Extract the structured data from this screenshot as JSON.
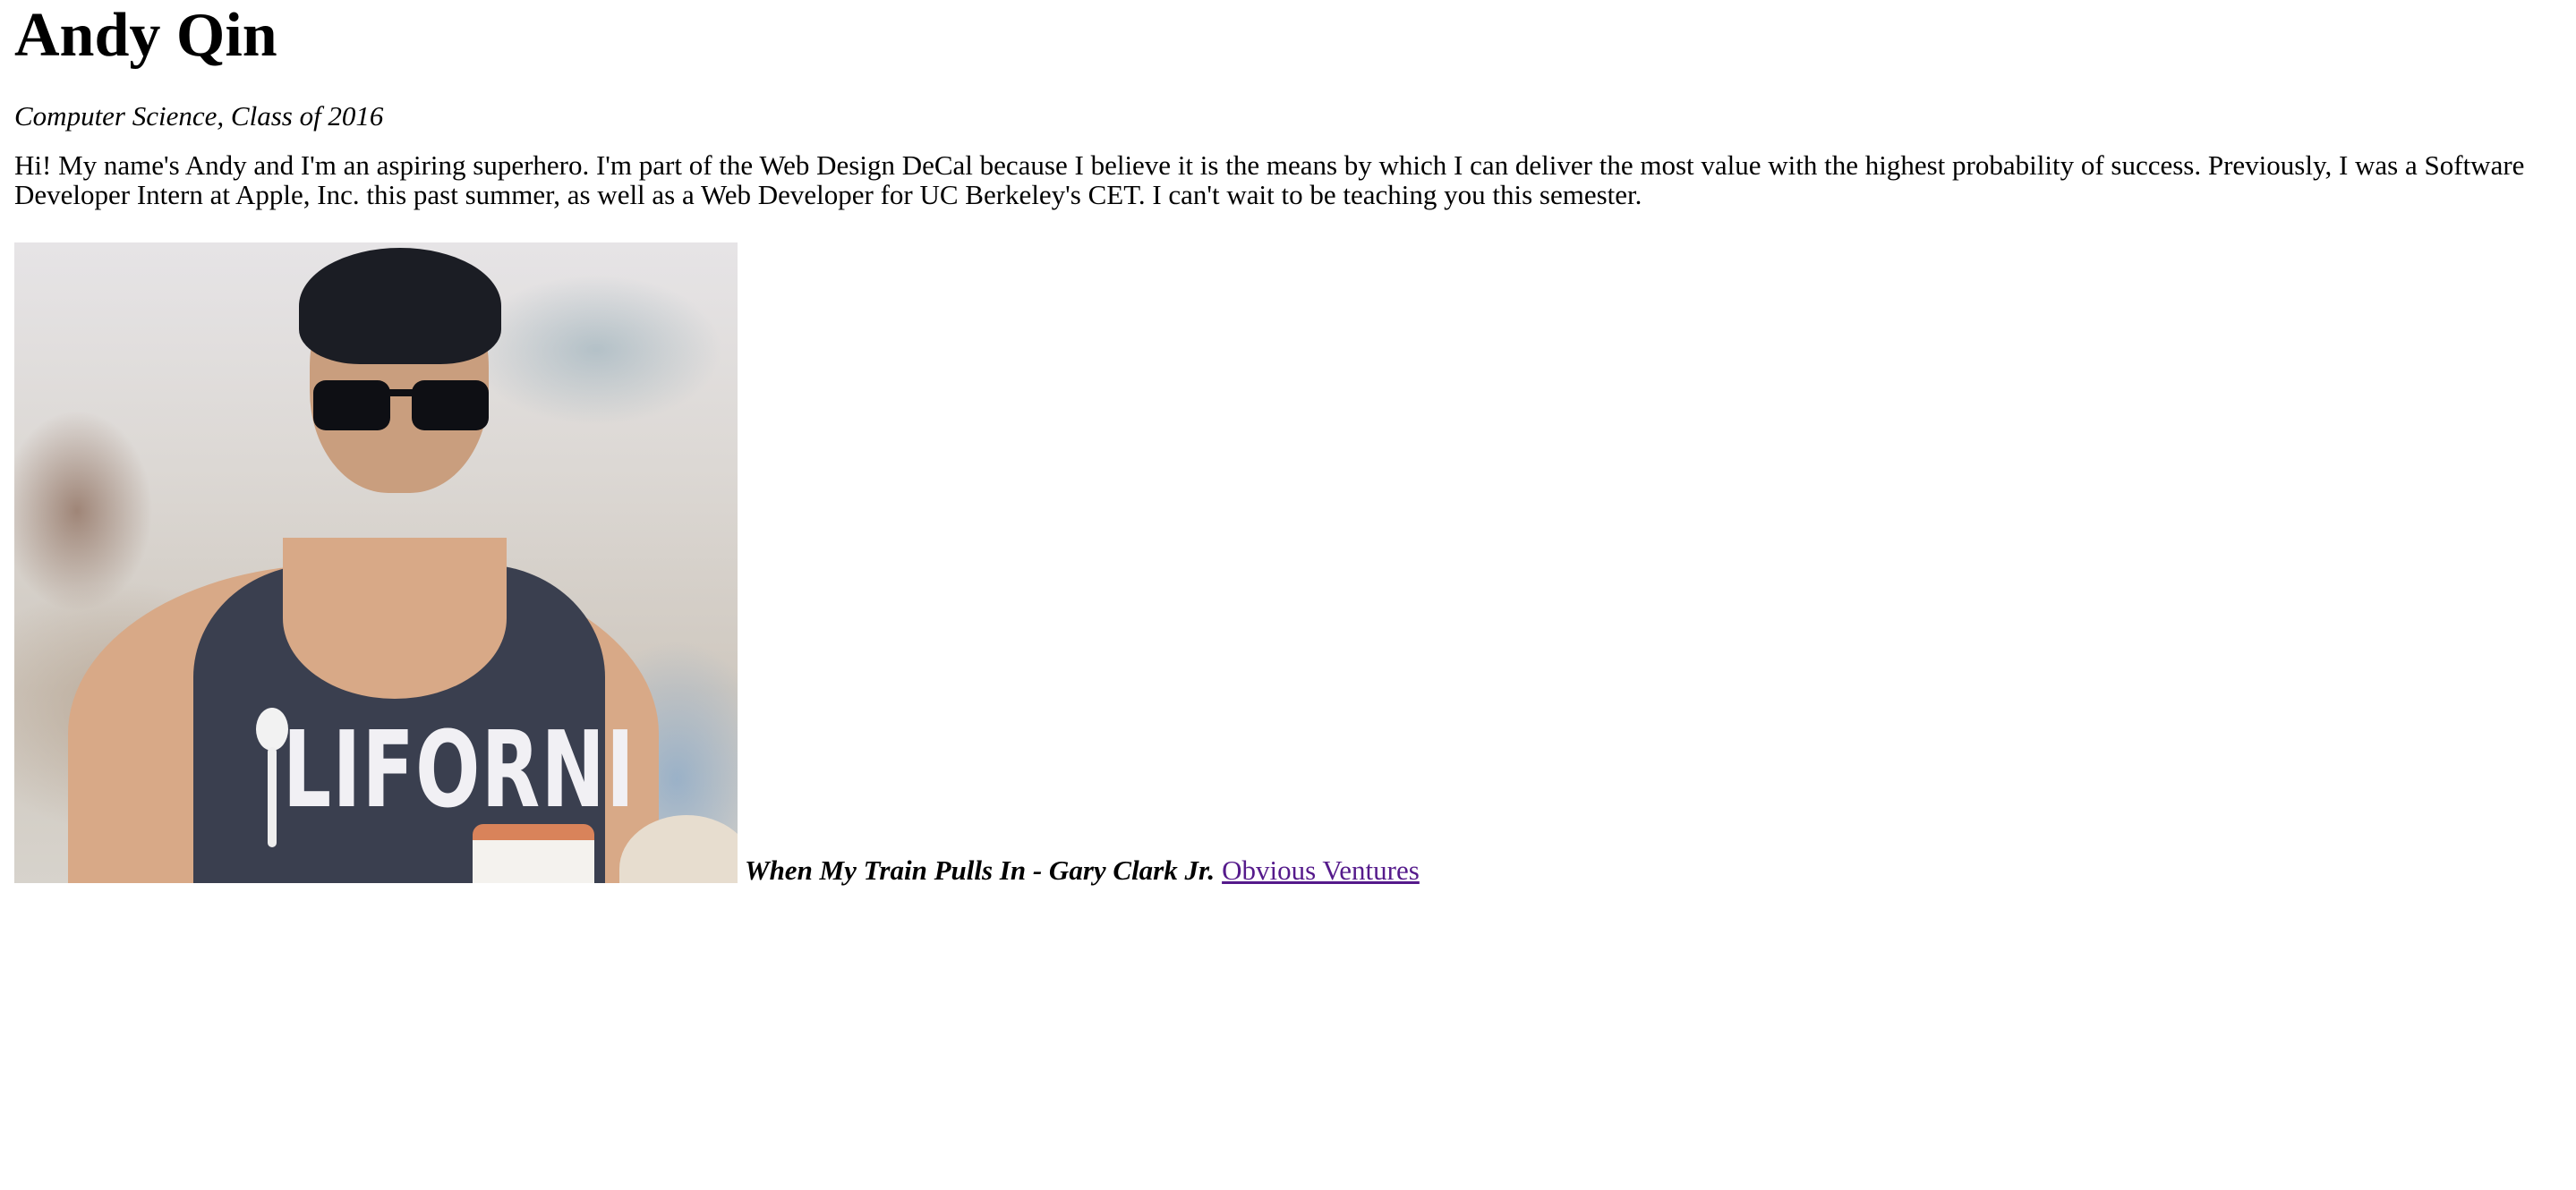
{
  "profile": {
    "name": "Andy Qin",
    "major": "Computer Science, Class of 2016",
    "bio": "Hi! My name's Andy and I'm an aspiring superhero. I'm part of the Web Design DeCal because I believe it is the means by which I can deliver the most value with the highest probability of success. Previously, I was a Software Developer Intern at Apple, Inc. this past summer, as well as a Web Developer for UC Berkeley's CET. I can't wait to be teaching you this semester.",
    "photo_shirt_text": "LIFORNI",
    "favorite_song": "When My Train Pulls In - Gary Clark Jr.",
    "link_text": "Obvious Ventures"
  },
  "colors": {
    "text": "#000000",
    "visited_link": "#551a8b",
    "background": "#ffffff"
  }
}
